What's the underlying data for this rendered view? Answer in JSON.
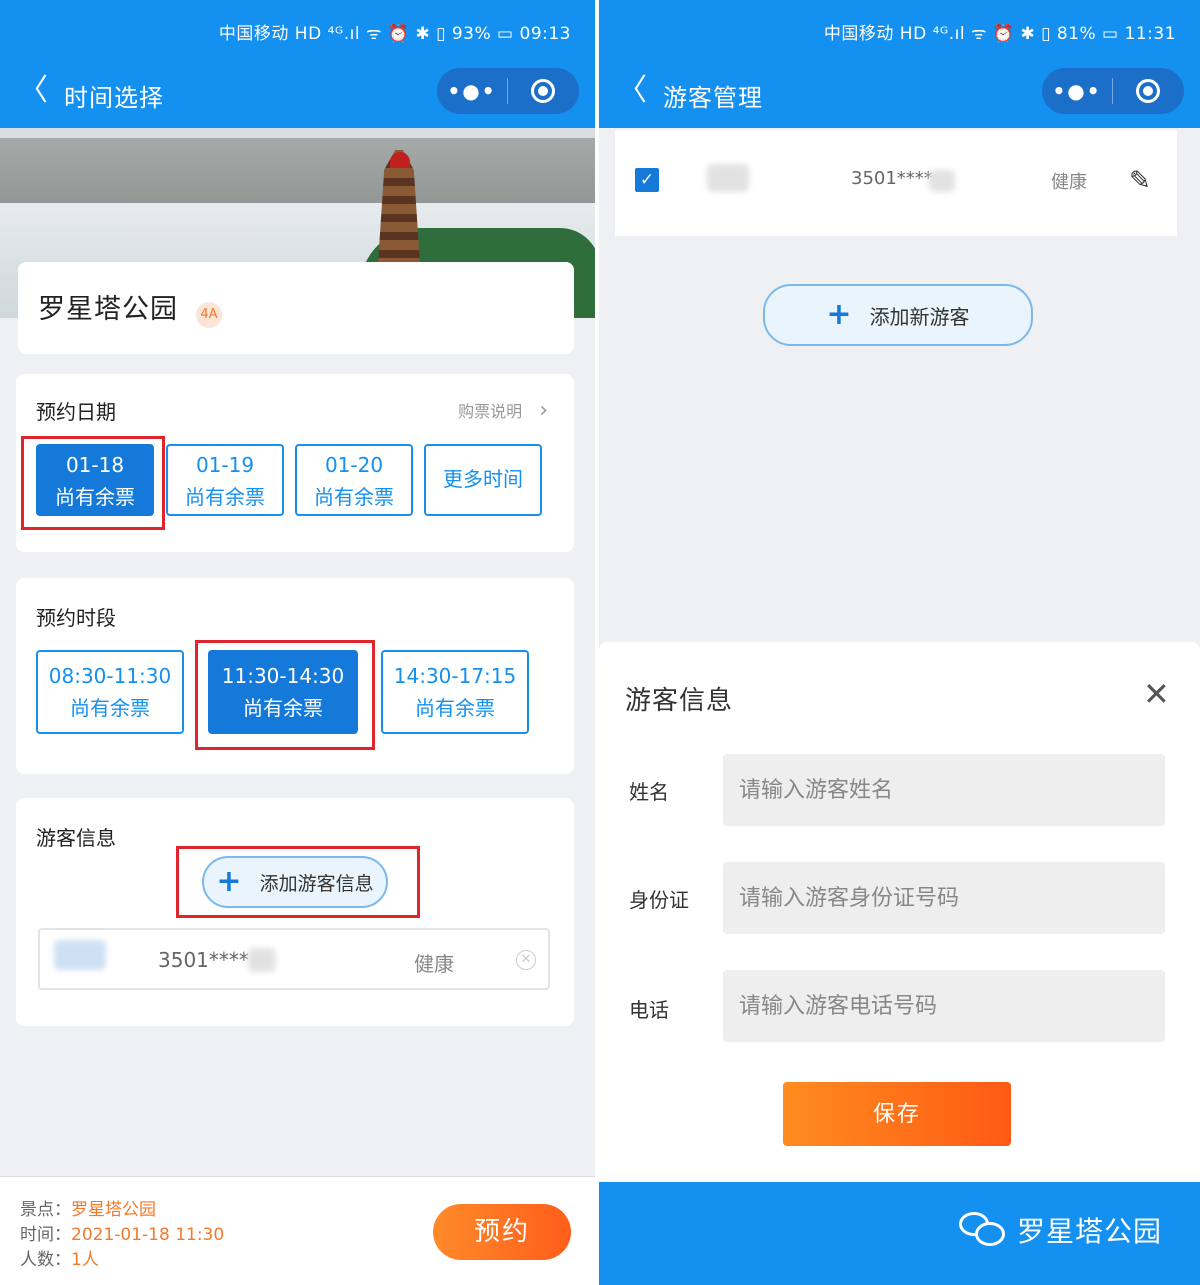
{
  "left": {
    "status": {
      "text": "中国移动 HD ⁴ᴳ.ıl ᯤ ⏰ ✱ ▯ 93% ▭ 09:13"
    },
    "nav": {
      "back": "〈",
      "title": "时间选择",
      "more": "•●•"
    },
    "park": {
      "name": "罗星塔公园",
      "badge": "4A"
    },
    "date_section": {
      "title": "预约日期",
      "link": "购票说明",
      "link_arrow": "›",
      "options": [
        {
          "date": "01-18",
          "status": "尚有余票",
          "selected": true
        },
        {
          "date": "01-19",
          "status": "尚有余票",
          "selected": false
        },
        {
          "date": "01-20",
          "status": "尚有余票",
          "selected": false
        }
      ],
      "more": "更多时间"
    },
    "time_section": {
      "title": "预约时段",
      "options": [
        {
          "range": "08:30-11:30",
          "status": "尚有余票",
          "selected": false
        },
        {
          "range": "11:30-14:30",
          "status": "尚有余票",
          "selected": true
        },
        {
          "range": "14:30-17:15",
          "status": "尚有余票",
          "selected": false
        }
      ]
    },
    "visitor_section": {
      "title": "游客信息",
      "add_label": "添加游客信息",
      "plus": "+",
      "row": {
        "id": "3501****",
        "health": "健康",
        "remove": "✕"
      }
    },
    "summary": {
      "spot_label": "景点：",
      "spot": "罗星塔公园",
      "time_label": "时间：",
      "time": "2021-01-18 11:30",
      "count_label": "人数：",
      "count": "1人",
      "book": "预约"
    }
  },
  "right": {
    "status": {
      "text": "中国移动 HD ⁴ᴳ.ıl ᯤ ⏰ ✱ ▯ 81% ▭ 11:31"
    },
    "nav": {
      "back": "〈",
      "title": "游客管理",
      "more": "•●•"
    },
    "visitor_row": {
      "checked": "✓",
      "id": "3501****",
      "health": "健康",
      "edit": "✎"
    },
    "add_new": {
      "plus": "+",
      "label": "添加新游客"
    },
    "sheet": {
      "title": "游客信息",
      "close": "✕",
      "fields": [
        {
          "label": "姓名",
          "placeholder": "请输入游客姓名"
        },
        {
          "label": "身份证",
          "placeholder": "请输入游客身份证号码"
        },
        {
          "label": "电话",
          "placeholder": "请输入游客电话号码"
        }
      ],
      "save": "保存"
    },
    "footer": {
      "brand": "罗星塔公园"
    }
  },
  "colors": {
    "primary": "#1490f0",
    "accent_orange": "#ff6a1f",
    "highlight_red": "#e0242b"
  }
}
